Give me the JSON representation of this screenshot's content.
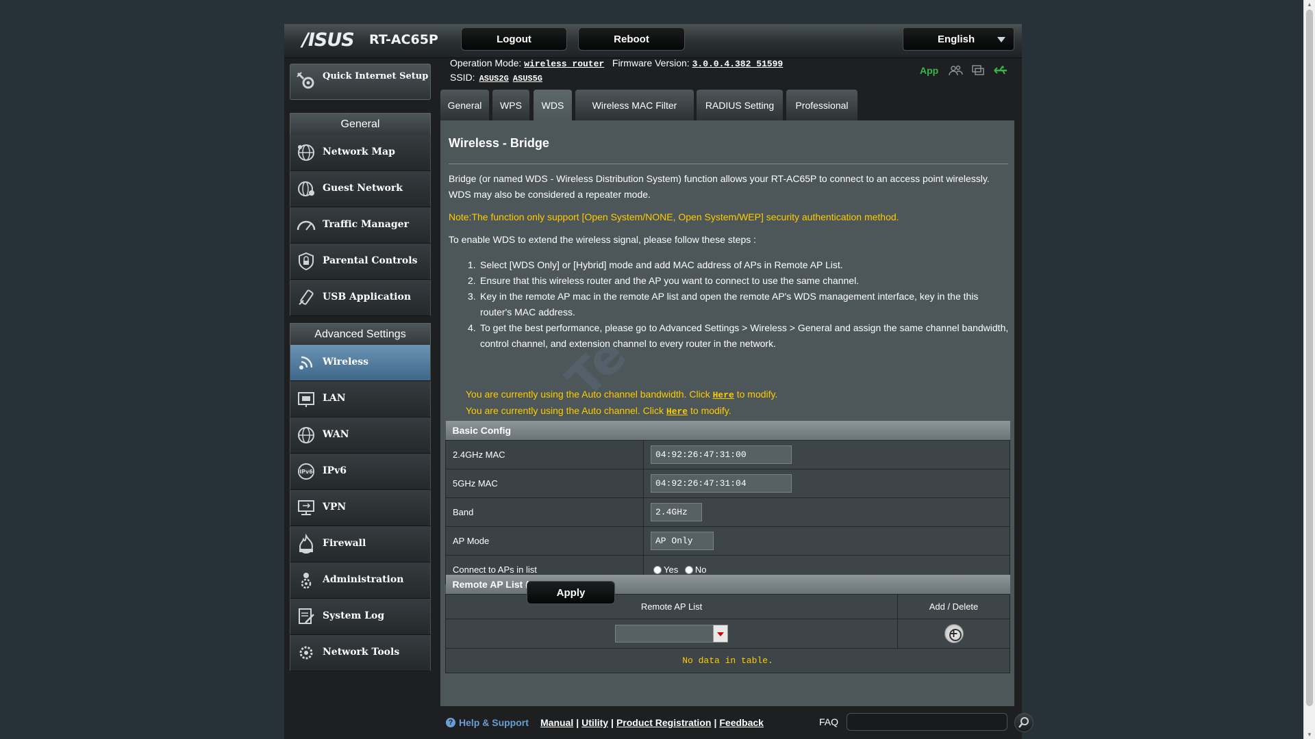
{
  "header": {
    "brand": "/ISUS",
    "model": "RT-AC65P",
    "logout_label": "Logout",
    "reboot_label": "Reboot",
    "language": "English"
  },
  "status": {
    "op_mode_label": "Operation Mode:",
    "op_mode_value": "wireless router",
    "firmware_label": "Firmware Version:",
    "firmware_value": "3.0.0.4.382_51599",
    "ssid_label": "SSID:",
    "ssid_2g": "ASUS2G",
    "ssid_5g": "ASUS5G",
    "app_label": "App"
  },
  "sidebar": {
    "quick_setup": "Quick Internet Setup",
    "general_header": "General",
    "general_items": [
      "Network Map",
      "Guest Network",
      "Traffic Manager",
      "Parental Controls",
      "USB Application"
    ],
    "advanced_header": "Advanced Settings",
    "advanced_items": [
      "Wireless",
      "LAN",
      "WAN",
      "IPv6",
      "VPN",
      "Firewall",
      "Administration",
      "System Log",
      "Network Tools"
    ]
  },
  "tabs": [
    "General",
    "WPS",
    "WDS",
    "Wireless MAC Filter",
    "RADIUS Setting",
    "Professional"
  ],
  "page": {
    "title": "Wireless - Bridge",
    "intro": "Bridge (or named WDS - Wireless Distribution System) function allows your RT-AC65P to connect to an access point wirelessly. WDS may also be considered a repeater mode.",
    "note": "Note:The function only support [Open System/NONE, Open System/WEP] security authentication method.",
    "steps_intro": "To enable WDS to extend the wireless signal, please follow these steps :",
    "steps": [
      "Select [WDS Only] or [Hybrid] mode and add MAC address of APs in Remote AP List.",
      "Ensure that this wireless router and the AP you want to connect to use the same channel.",
      "Key in the remote AP mac in the remote AP list and open the remote AP's WDS management interface, key in the this router's MAC address.",
      "To get the best performance, please go to Advanced Settings > Wireless > General and assign the same channel bandwidth, control channel, and extension channel to every router in the network."
    ],
    "hint1_pre": "You are currently using the Auto channel bandwidth. Click",
    "hint2_pre": "You are currently using the Auto channel. Click",
    "here_label": "Here",
    "hint_post": "to modify."
  },
  "basic_config": {
    "title": "Basic Config",
    "mac24_label": "2.4GHz MAC",
    "mac24_value": "04:92:26:47:31:00",
    "mac5_label": "5GHz MAC",
    "mac5_value": "04:92:26:47:31:04",
    "band_label": "Band",
    "band_value": "2.4GHz",
    "ap_mode_label": "AP Mode",
    "ap_mode_value": "AP Only",
    "connect_label": "Connect to APs in list",
    "yes_label": "Yes",
    "no_label": "No"
  },
  "remote_ap": {
    "title": "Remote AP List (Max Limit : 4)",
    "col_list": "Remote AP List",
    "col_action": "Add / Delete",
    "empty": "No data in table."
  },
  "apply_label": "Apply",
  "footer": {
    "help_label": "Help & Support",
    "links": [
      "Manual",
      "Utility",
      "Product Registration",
      "Feedback"
    ],
    "faq_label": "FAQ"
  },
  "colors": {
    "note_yellow": "#ffcc00",
    "app_green": "#39b54a",
    "active_nav": "#5a84a8",
    "help_blue": "#6a9fd6"
  }
}
